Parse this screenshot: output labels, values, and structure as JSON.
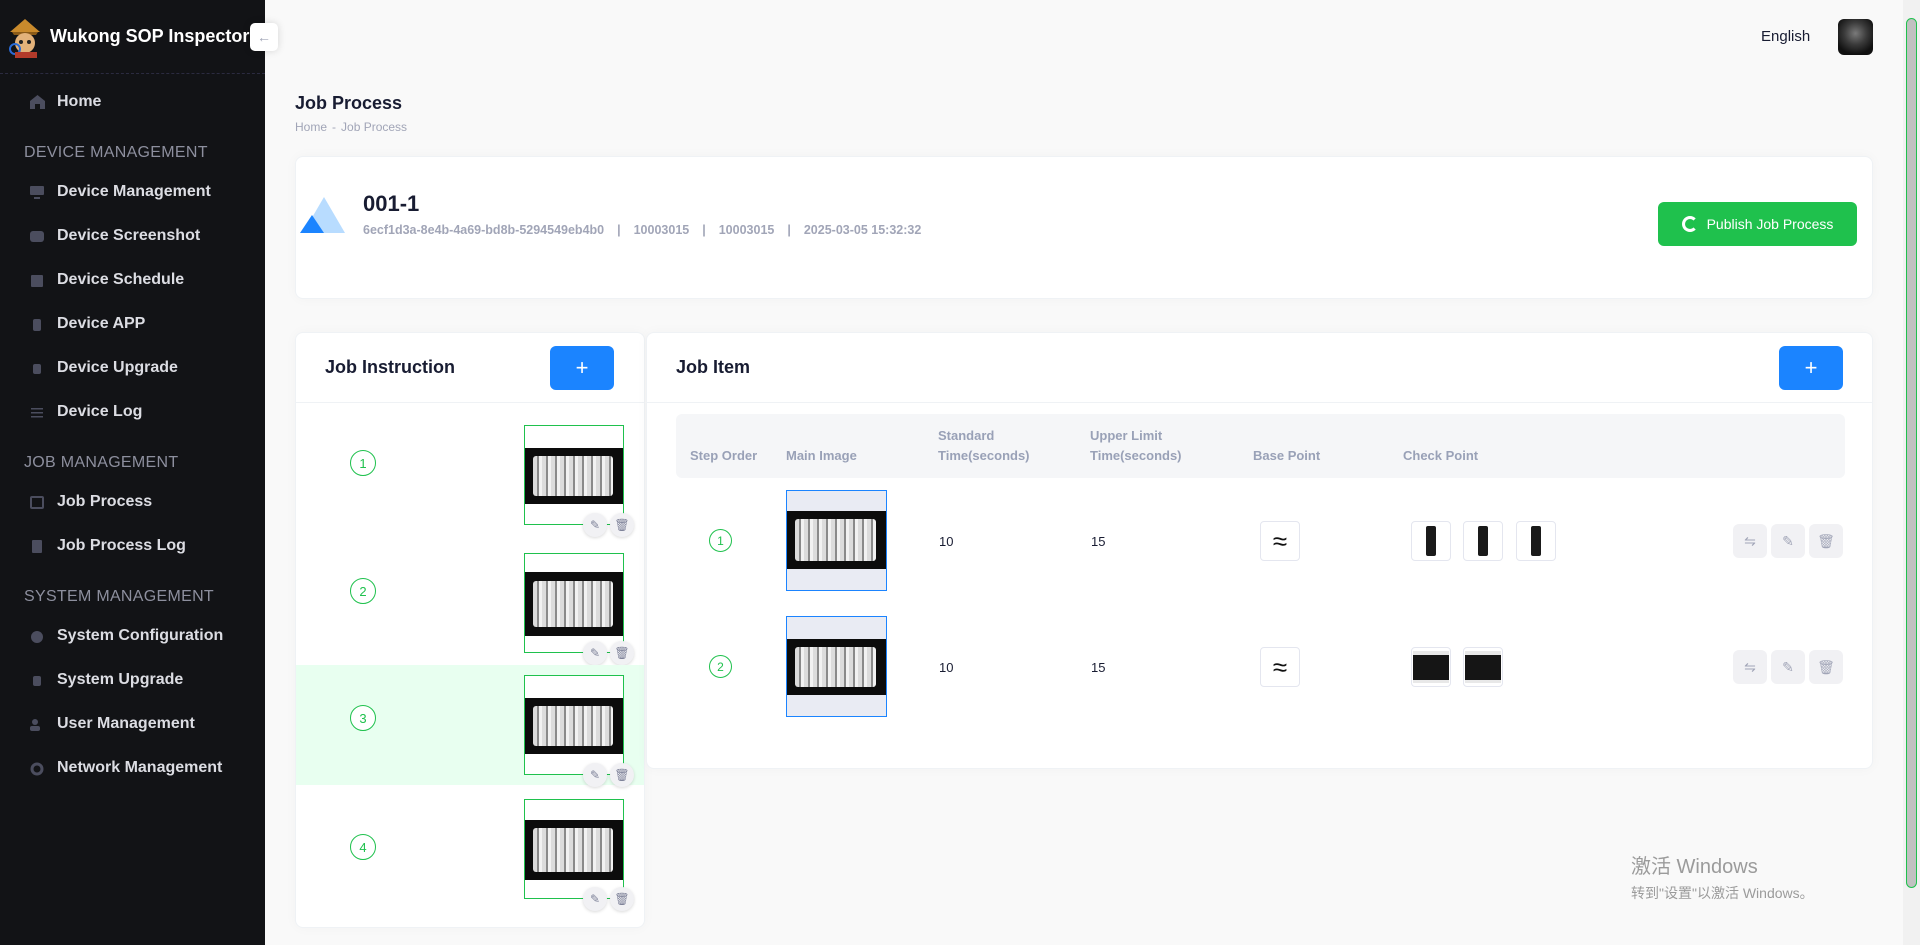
{
  "app": {
    "title": "Wukong SOP Inspector",
    "collapse_icon": "arrow-left-icon"
  },
  "sidebar": {
    "home": "Home",
    "sections": [
      {
        "title": "DEVICE MANAGEMENT",
        "items": [
          "Device Management",
          "Device Screenshot",
          "Device Schedule",
          "Device APP",
          "Device Upgrade",
          "Device Log"
        ]
      },
      {
        "title": "JOB MANAGEMENT",
        "items": [
          "Job Process",
          "Job Process Log"
        ]
      },
      {
        "title": "SYSTEM MANAGEMENT",
        "items": [
          "System Configuration",
          "System Upgrade",
          "User Management",
          "Network Management"
        ]
      }
    ]
  },
  "header": {
    "language": "English"
  },
  "page": {
    "title": "Job Process",
    "breadcrumb": [
      "Home",
      "Job Process"
    ],
    "breadcrumb_sep": "-"
  },
  "job": {
    "name": "001-1",
    "meta": [
      "6ecf1d3a-8e4b-4a69-bd8b-5294549eb4b0",
      "10003015",
      "10003015",
      "2025-03-05 15:32:32"
    ],
    "meta_sep": "|",
    "publish_label": "Publish Job Process"
  },
  "instruction": {
    "title": "Job Instruction",
    "add_label": "+",
    "steps": [
      "1",
      "2",
      "3",
      "4"
    ],
    "active_step": "3"
  },
  "job_item": {
    "title": "Job Item",
    "add_label": "+",
    "columns": {
      "step_order": "Step Order",
      "main_image": "Main Image",
      "standard_time": [
        "Standard",
        "Time(seconds)"
      ],
      "upper_limit": [
        "Upper Limit",
        "Time(seconds)"
      ],
      "base_point": "Base Point",
      "check_point": "Check Point"
    },
    "rows": [
      {
        "step": "1",
        "standard": "10",
        "upper": "15",
        "check_points": 3
      },
      {
        "step": "2",
        "standard": "10",
        "upper": "15",
        "check_points": 2
      }
    ]
  },
  "watermark": {
    "line1": "激活 Windows",
    "line2": "转到\"设置\"以激活 Windows。"
  },
  "colors": {
    "sidebar": "#121316",
    "primary": "#1b84ff",
    "success": "#1fc14d",
    "active_row": "#e8fff0"
  }
}
